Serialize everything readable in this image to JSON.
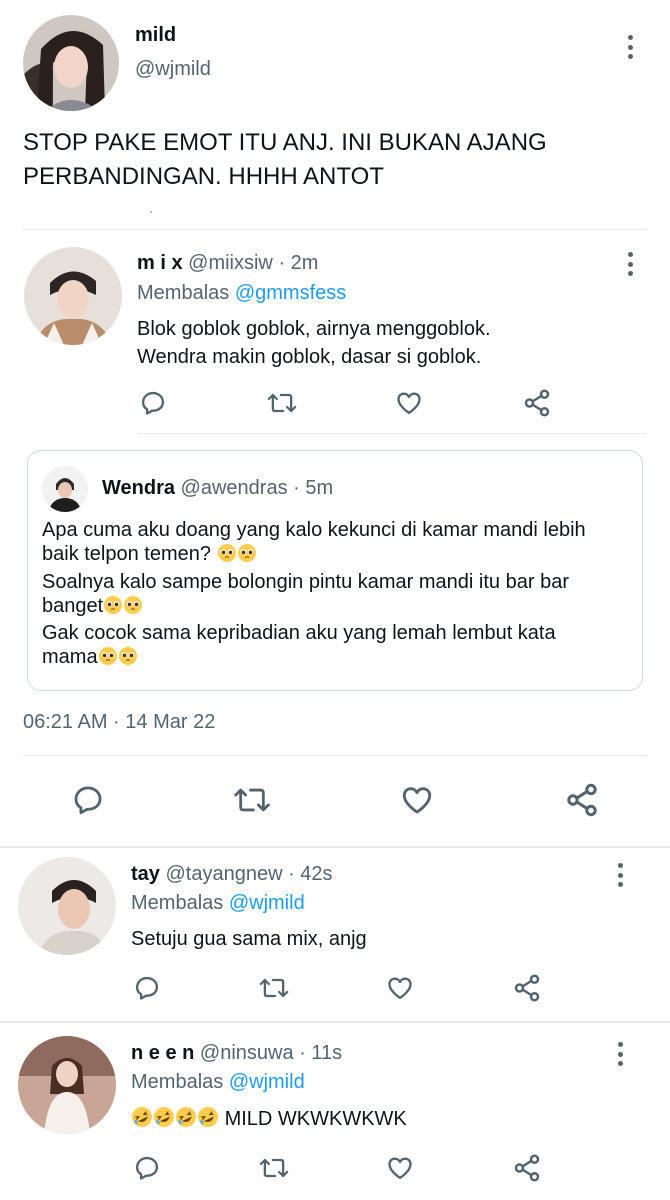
{
  "main_tweet": {
    "name": "mild",
    "handle": "@wjmild",
    "text_line1": "STOP PAKE EMOT ITU ANJ. INI BUKAN AJANG",
    "text_line2": "PERBANDINGAN. HHHH ANTOT",
    "timestamp": "06:21 AM · 14 Mar 22"
  },
  "reply_parent": {
    "name": "m i x",
    "handle": "@miixsiw",
    "time": "· 2m",
    "replying_label": "Membalas",
    "replying_to": "@gmmsfess",
    "text_line1": "Blok goblok goblok, airnya menggoblok.",
    "text_line2": "Wendra makin goblok, dasar si goblok."
  },
  "quoted_tweet": {
    "name": "Wendra",
    "handle": "@awendras",
    "time": "· 5m",
    "line1": "Apa cuma aku doang yang kalo kekunci di kamar mandi lebih",
    "line2": "baik telpon temen?",
    "line3": "Soalnya kalo sampe bolongin pintu kamar mandi itu bar bar",
    "line4": "banget",
    "line5": "Gak cocok sama kepribadian aku yang lemah lembut kata",
    "line6": "mama"
  },
  "replies": [
    {
      "name": "tay",
      "handle": "@tayangnew",
      "time": "· 42s",
      "replying_label": "Membalas",
      "replying_to": "@wjmild",
      "text": "Setuju gua sama mix, anjg"
    },
    {
      "name": "n e e n",
      "handle": "@ninsuwa",
      "time": "· 11s",
      "replying_label": "Membalas",
      "replying_to": "@wjmild",
      "text": "MILD WKWKWKWK"
    }
  ],
  "icons": {
    "reply": "speech-bubble-icon",
    "retweet": "retweet-icon",
    "like": "heart-icon",
    "share": "share-icon",
    "more": "vertical-dots-icon",
    "pleading": "pleading-face-emoji",
    "rofl": "rolling-laughing-emoji"
  },
  "colors": {
    "text": "#0f1419",
    "secondary": "#536471",
    "link": "#1d9bf0",
    "divider": "#e7e9ea"
  }
}
